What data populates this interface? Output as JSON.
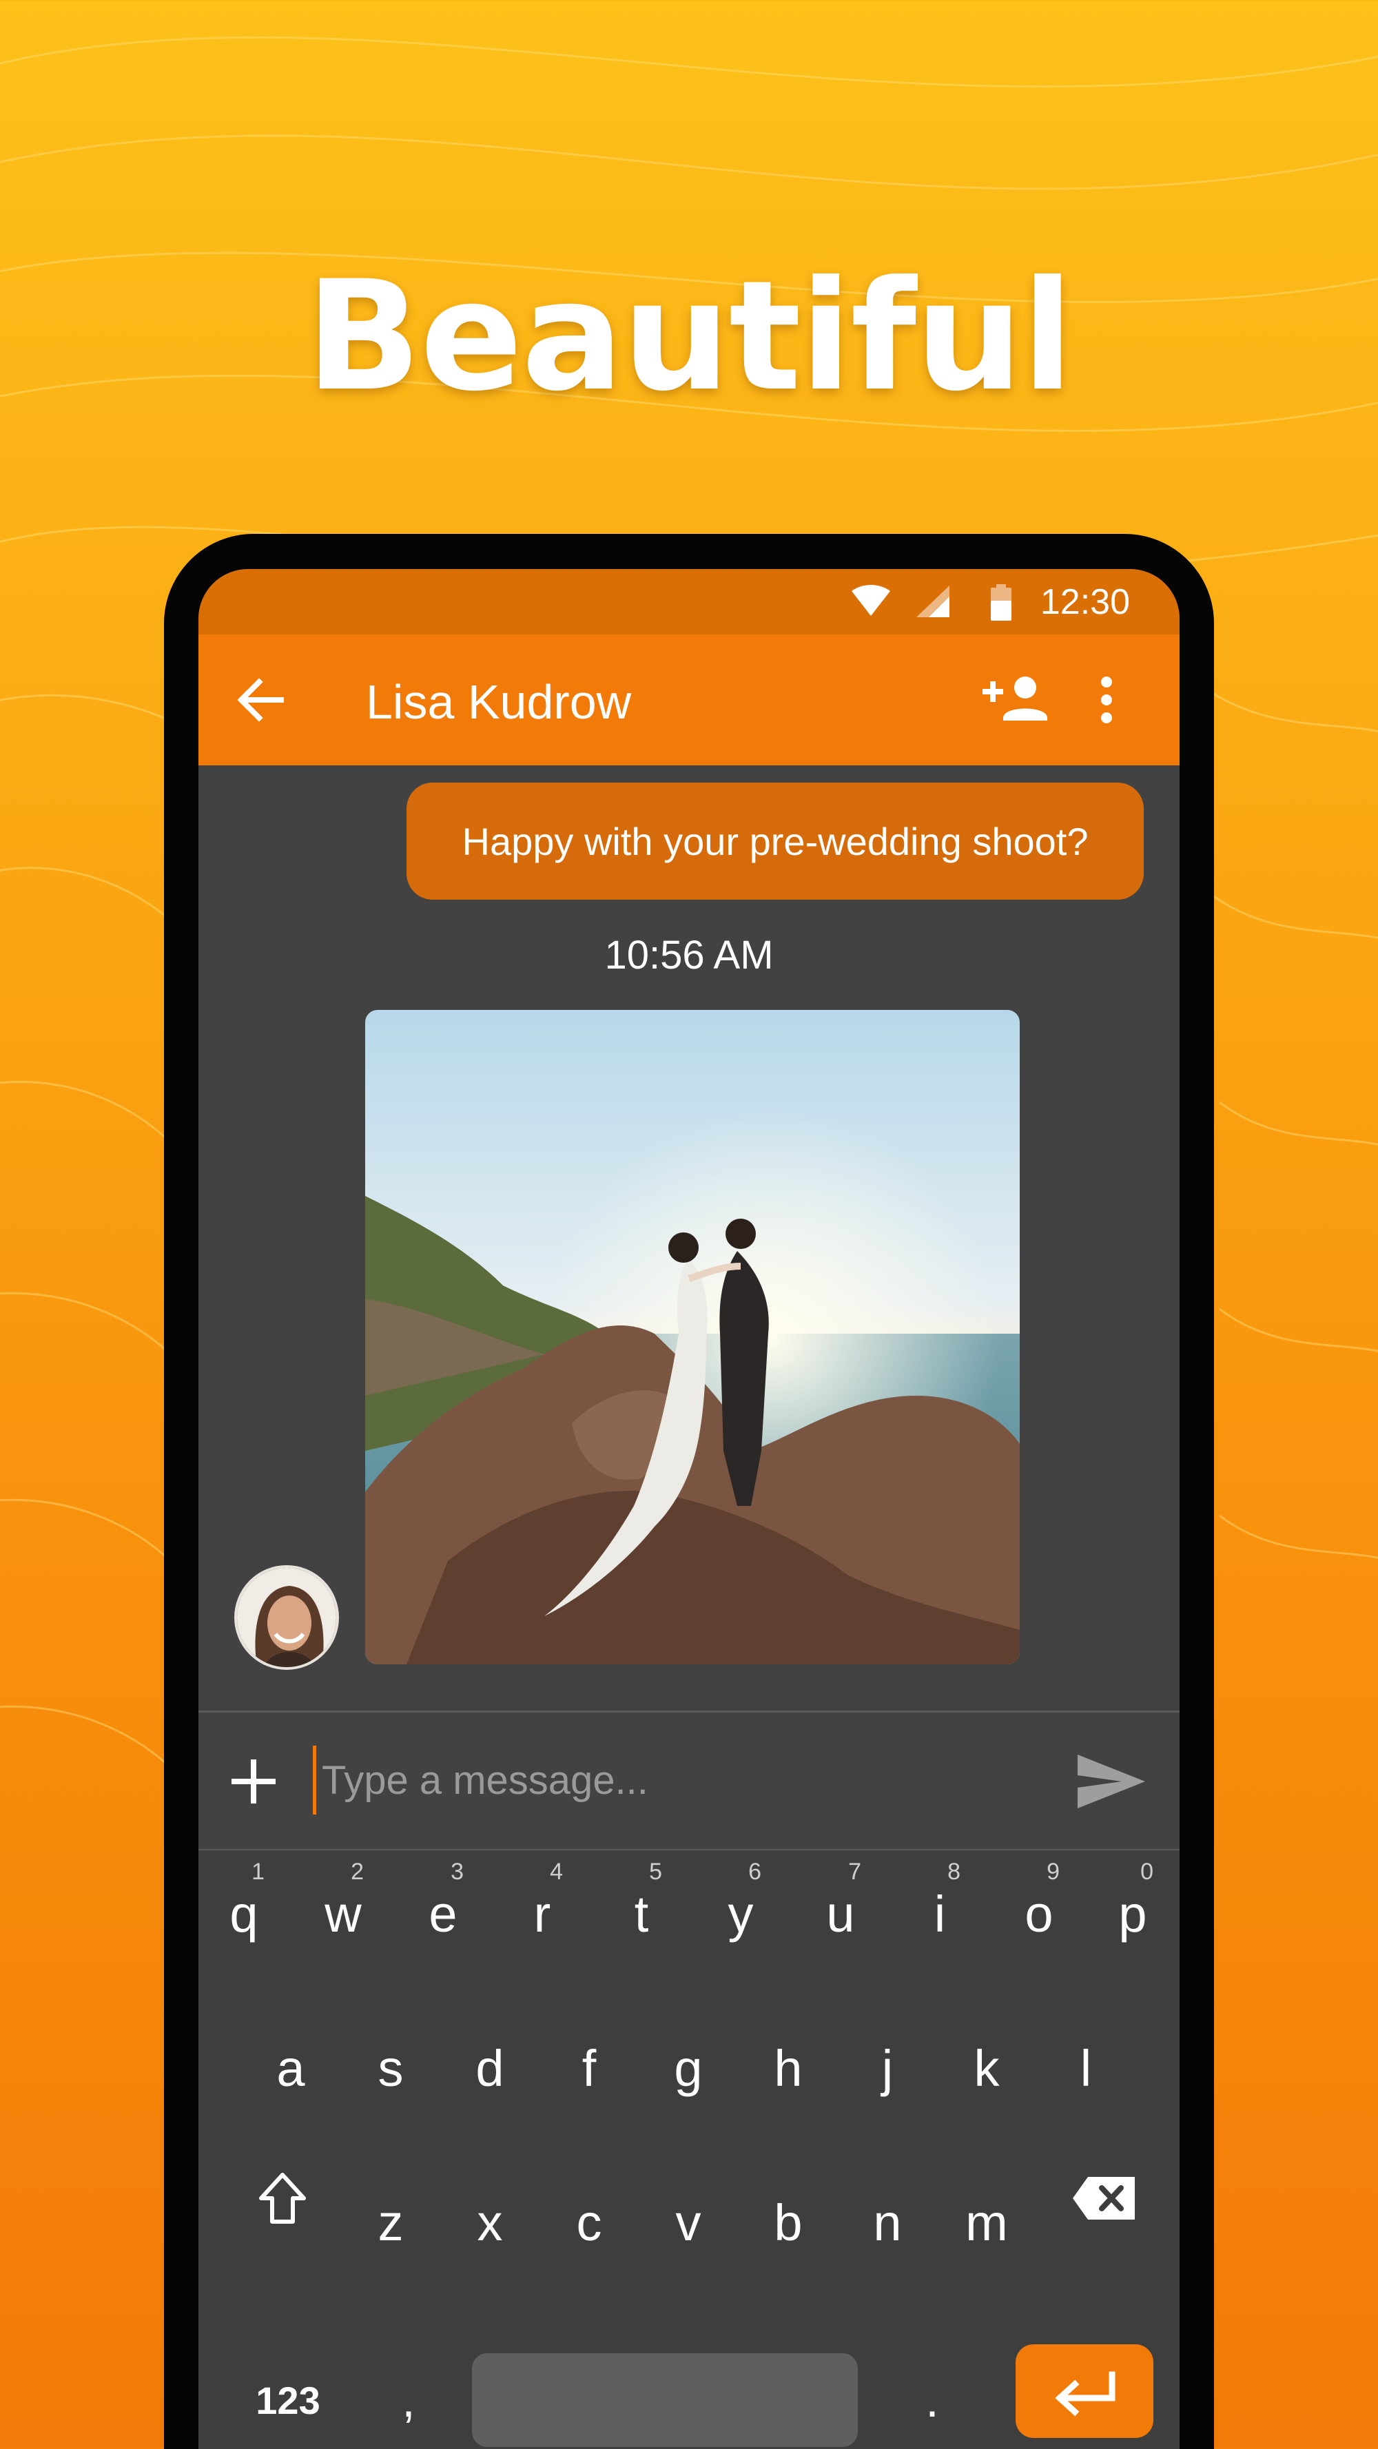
{
  "headline": "Beautiful",
  "status_bar": {
    "time": "12:30",
    "icons": [
      "wifi-icon",
      "signal-icon",
      "battery-icon"
    ]
  },
  "app_bar": {
    "contact_name": "Lisa Kudrow",
    "icons": [
      "back-arrow-icon",
      "add-contact-icon",
      "more-vertical-icon"
    ]
  },
  "conversation": {
    "outgoing_message": "Happy with your pre-wedding shoot?",
    "timestamp": "10:56 AM"
  },
  "composer": {
    "placeholder": "Type a message...",
    "icons": [
      "plus-icon",
      "send-icon"
    ]
  },
  "keyboard": {
    "row1": [
      {
        "key": "q",
        "hint": "1"
      },
      {
        "key": "w",
        "hint": "2"
      },
      {
        "key": "e",
        "hint": "3"
      },
      {
        "key": "r",
        "hint": "4"
      },
      {
        "key": "t",
        "hint": "5"
      },
      {
        "key": "y",
        "hint": "6"
      },
      {
        "key": "u",
        "hint": "7"
      },
      {
        "key": "i",
        "hint": "8"
      },
      {
        "key": "o",
        "hint": "9"
      },
      {
        "key": "p",
        "hint": "0"
      }
    ],
    "row2": [
      "a",
      "s",
      "d",
      "f",
      "g",
      "h",
      "j",
      "k",
      "l"
    ],
    "row3": [
      "z",
      "x",
      "c",
      "v",
      "b",
      "n",
      "m"
    ],
    "row4": {
      "numbers": "123",
      "comma": ",",
      "period": "."
    }
  },
  "colors": {
    "accent": "#f27a09",
    "status_bar": "#d96f05",
    "outgoing_bubble": "#d56b0b",
    "chat_background": "#424242",
    "keyboard_background": "#3e3e3e"
  }
}
